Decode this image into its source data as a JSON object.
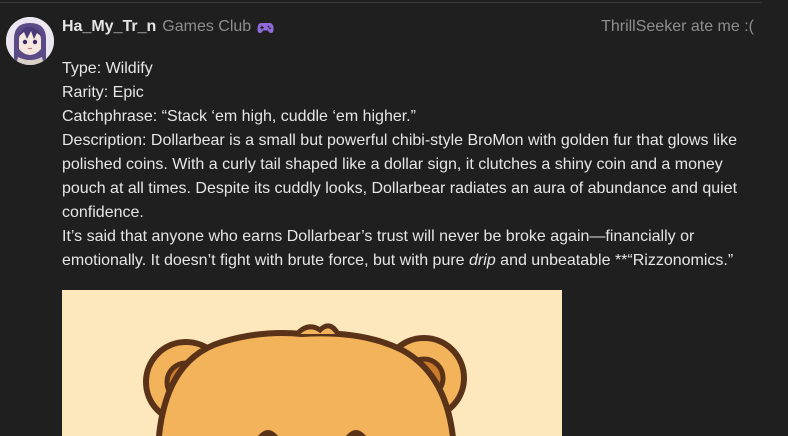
{
  "post": {
    "username": "Ha_My_Tr_n",
    "club": "Games Club",
    "club_icon": "gamepad-icon",
    "status": "ThrillSeeker ate me :(",
    "lines": {
      "type": "Type: Wildify",
      "rarity": "Rarity: Epic",
      "catchphrase": "Catchphrase: “Stack ‘em high, cuddle ‘em higher.”",
      "description": "Description: Dollarbear is a small but powerful chibi-style BroMon with golden fur that glows like polished coins. With a curly tail shaped like a dollar sign, it clutches a shiny coin and a money pouch at all times. Despite its cuddly looks, Dollarbear radiates an aura of abundance and quiet confidence.",
      "trust_before": "It’s said that anyone who earns Dollarbear’s trust will never be broke again—financially or emotionally. It doesn’t fight with brute force, but with pure ",
      "trust_em": "drip",
      "trust_after": " and unbeatable **“Rizzonomics.”"
    }
  },
  "colors": {
    "background": "#1f1f1f",
    "text": "#e6e6e6",
    "muted": "#8e8e8e",
    "image_bg": "#fde8bd",
    "bear_fur": "#f2b35b",
    "bear_outline": "#5a3218",
    "gamepad": "#8f6ad8"
  }
}
